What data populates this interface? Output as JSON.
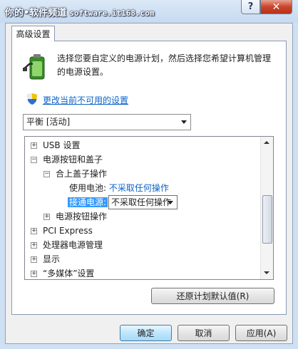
{
  "watermark": {
    "text": "你的•软件频道",
    "url": "software.it168.com"
  },
  "caption": {
    "help": "?",
    "close": "✕"
  },
  "tab": {
    "label": "高级设置"
  },
  "description": "选择您要自定义的电源计划，然后选择您希望计算机管理的电源设置。",
  "change_link": "更改当前不可用的设置",
  "plan_select": {
    "value": "平衡 [活动]"
  },
  "tree": {
    "usb": {
      "expander": "+",
      "label": "USB 设置"
    },
    "power_buttons": {
      "expander": "−",
      "label": "电源按钮和盖子"
    },
    "lid_action": {
      "expander": "−",
      "label": "合上盖子操作"
    },
    "battery": {
      "label": "使用电池:",
      "value": "不采取任何操作"
    },
    "plugged_in": {
      "label": "接通电源:",
      "value": "不采取任何操作"
    },
    "power_button_action": {
      "expander": "+",
      "label": "电源按钮操作"
    },
    "pci_express": {
      "expander": "+",
      "label": "PCI Express"
    },
    "cpu_power": {
      "expander": "+",
      "label": "处理器电源管理"
    },
    "display": {
      "expander": "+",
      "label": "显示"
    },
    "multimedia": {
      "expander": "+",
      "label": "“多媒体”设置"
    }
  },
  "buttons": {
    "restore": "还原计划默认值(R)",
    "ok": "确定",
    "cancel": "取消",
    "apply": "应用(A)"
  },
  "colors": {
    "link": "#0b64c8",
    "selection": "#3399ff"
  }
}
